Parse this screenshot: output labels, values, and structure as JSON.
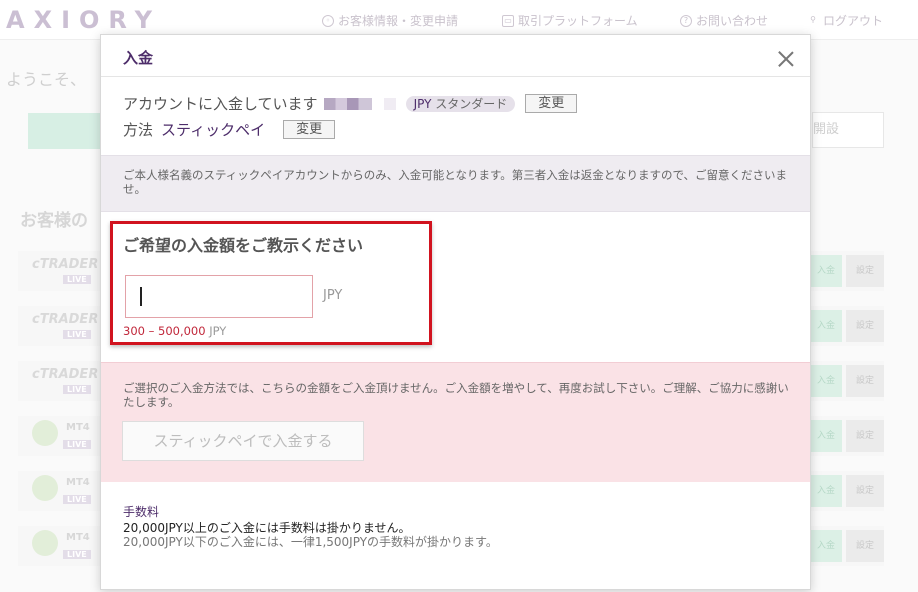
{
  "background": {
    "logo": "AXIORY",
    "nav": [
      {
        "label": "お客様情報・変更申請",
        "icon": "user-circle-icon"
      },
      {
        "label": "取引プラットフォーム",
        "icon": "platform-icon"
      },
      {
        "label": "お問い合わせ",
        "icon": "question-icon"
      },
      {
        "label": "ログアウト",
        "icon": "logout-icon"
      }
    ],
    "welcome": "ようこそ、",
    "settings_tab": "開設",
    "section_title": "お客様の",
    "row_deposit_label": "入金",
    "row_settings_label": "設定",
    "rows": [
      {
        "platform": "cTRADER",
        "badge": "LIVE"
      },
      {
        "platform": "cTRADER",
        "badge": "LIVE"
      },
      {
        "platform": "cTRADER",
        "badge": "LIVE"
      },
      {
        "platform": "MT4",
        "badge": "LIVE"
      },
      {
        "platform": "MT4",
        "badge": "LIVE"
      },
      {
        "platform": "MT4",
        "badge": "LIVE"
      }
    ]
  },
  "modal": {
    "title": "入金",
    "account_prefix": "アカウントに入金しています",
    "account_currency": "JPY",
    "account_type": "スタンダード",
    "change_label": "変更",
    "method_label": "方法",
    "method_value": "スティックペイ",
    "notice": "ご本人様名義のスティックペイアカウントからのみ、入金可能となります。第三者入金は返金となりますので、ご留意くださいませ。",
    "amount_label": "ご希望の入金額をご教示ください",
    "amount_value": "",
    "amount_currency": "JPY",
    "range_text": "300 – 500,000",
    "range_currency": "JPY",
    "error_text": "ご選択のご入金方法では、こちらの金額をご入金頂けません。ご入金額を増やして、再度お試し下さい。ご理解、ご協力に感謝いたします。",
    "submit_label": "スティックペイで入金する",
    "fee_title": "手数料",
    "fee_line1": "20,000JPY以上のご入金には手数料は掛かりません。",
    "fee_line2": "20,000JPY以下のご入金には、一律1,500JPYの手数料が掛かります。"
  }
}
